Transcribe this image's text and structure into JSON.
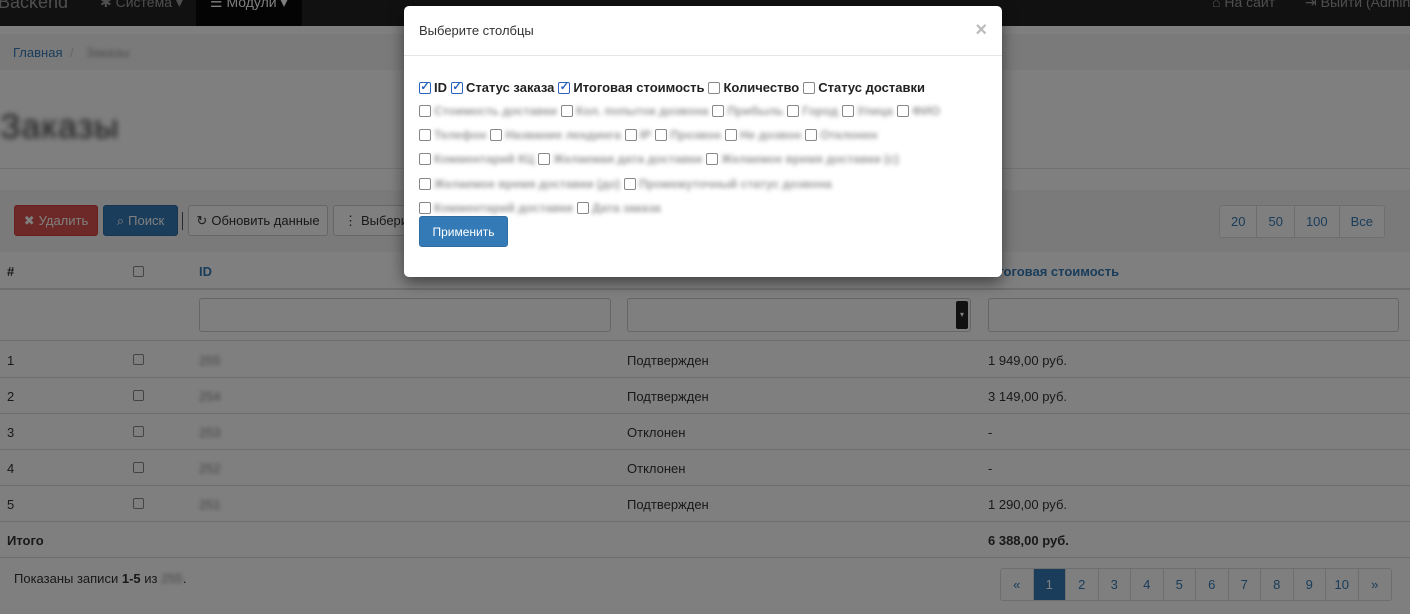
{
  "navbar": {
    "brand": "Backend",
    "system": "Система",
    "modules": "Модули",
    "to_site": "На сайт",
    "logout": "Выйти (Admin)"
  },
  "breadcrumb": {
    "home": "Главная",
    "sep": "/",
    "current": "Заказы"
  },
  "page_title": "Заказы",
  "toolbar": {
    "delete": "Удалить",
    "search": "Поиск",
    "refresh": "Обновить данные",
    "choose": "Выберите"
  },
  "page_sizes": [
    "20",
    "50",
    "100",
    "Все"
  ],
  "table": {
    "headers": {
      "num": "#",
      "id": "ID",
      "total": "Итоговая стоимость"
    },
    "rows": [
      {
        "num": "1",
        "id": "255",
        "status": "Подтвержден",
        "total": "1 949,00 руб."
      },
      {
        "num": "2",
        "id": "254",
        "status": "Подтвержден",
        "total": "3 149,00 руб."
      },
      {
        "num": "3",
        "id": "253",
        "status": "Отклонен",
        "total": "-"
      },
      {
        "num": "4",
        "id": "252",
        "status": "Отклонен",
        "total": "-"
      },
      {
        "num": "5",
        "id": "251",
        "status": "Подтвержден",
        "total": "1 290,00 руб."
      }
    ],
    "total_label": "Итого",
    "total_value": "6 388,00 руб."
  },
  "summary": {
    "prefix": "Показаны записи",
    "range": "1-5",
    "of": "из",
    "count": "255"
  },
  "pagination": [
    "«",
    "1",
    "2",
    "3",
    "4",
    "5",
    "6",
    "7",
    "8",
    "9",
    "10",
    "»"
  ],
  "pagination_active": "1",
  "modal": {
    "title": "Выберите столбцы",
    "close": "×",
    "columns": [
      {
        "label": "ID",
        "checked": true
      },
      {
        "label": "Статус заказа",
        "checked": true
      },
      {
        "label": "Итоговая стоимость",
        "checked": true
      },
      {
        "label": "Количество",
        "checked": false
      },
      {
        "label": "Статус доставки",
        "checked": false
      },
      {
        "label": "Стоимость доставки",
        "checked": false
      },
      {
        "label": "Кол. попыток дозвона",
        "checked": false
      },
      {
        "label": "Прибыль",
        "checked": false
      },
      {
        "label": "Город",
        "checked": false
      },
      {
        "label": "Улица",
        "checked": false
      },
      {
        "label": "ФИО",
        "checked": false
      },
      {
        "label": "Телефон",
        "checked": false
      },
      {
        "label": "Название лендинга",
        "checked": false
      },
      {
        "label": "IP",
        "checked": false
      },
      {
        "label": "Прозвон",
        "checked": false
      },
      {
        "label": "Не дозвон",
        "checked": false
      },
      {
        "label": "Отклонен",
        "checked": false
      },
      {
        "label": "Комментарий КЦ",
        "checked": false
      },
      {
        "label": "Желаемая дата доставки",
        "checked": false
      },
      {
        "label": "Желаемое время доставки (с)",
        "checked": false
      },
      {
        "label": "Желаемое время доставки (до)",
        "checked": false
      },
      {
        "label": "Промежуточный статус дозвона",
        "checked": false
      },
      {
        "label": "Комментарий доставки",
        "checked": false
      },
      {
        "label": "Дата заказа",
        "checked": false
      }
    ],
    "apply": "Применить"
  }
}
